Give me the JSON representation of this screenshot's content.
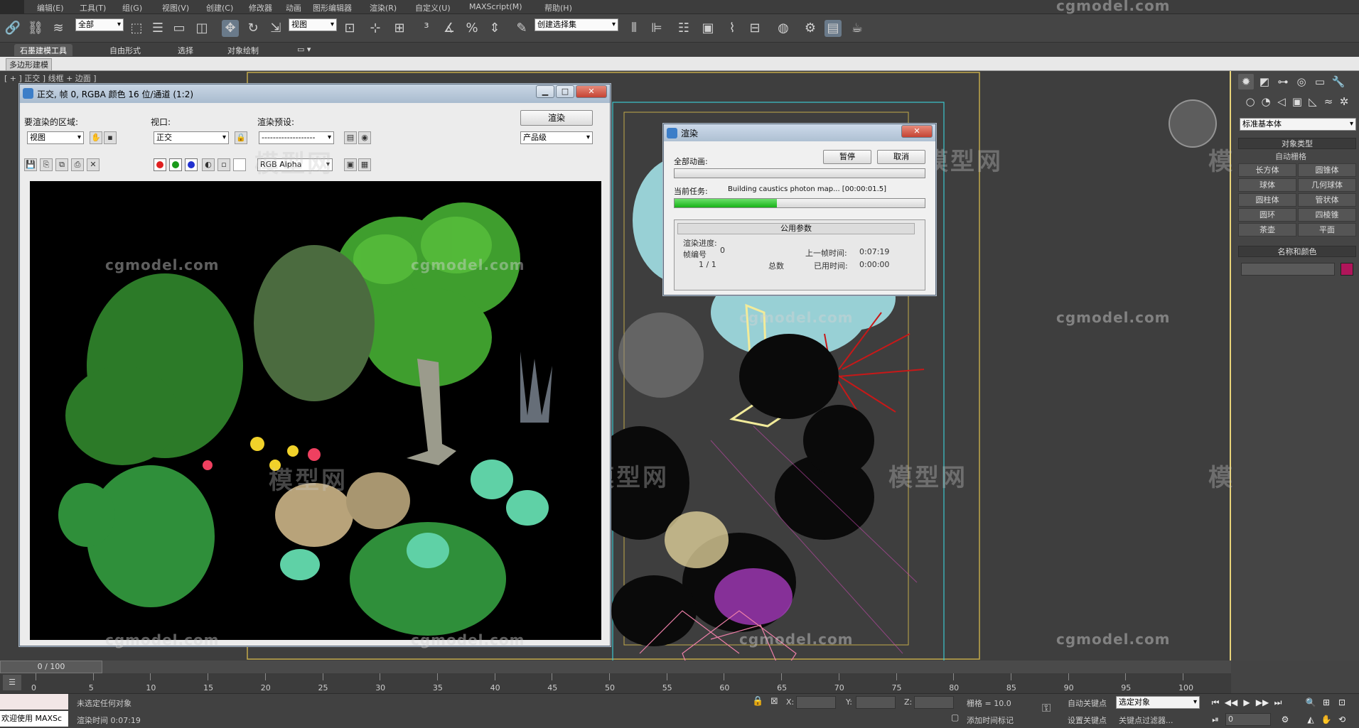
{
  "menubar": {
    "items": [
      "编辑(E)",
      "工具(T)",
      "组(G)",
      "视图(V)",
      "创建(C)",
      "修改器",
      "动画",
      "图形编辑器",
      "渲染(R)",
      "自定义(U)",
      "MAXScript(M)",
      "帮助(H)"
    ]
  },
  "toolbar": {
    "selection_filter": "全部",
    "ref_coord": "视图",
    "named_selection": "创建选择集"
  },
  "ribbon": {
    "tabs": [
      "石墨建模工具",
      "自由形式",
      "选择",
      "对象绘制"
    ],
    "sub_label": "多边形建模"
  },
  "viewport": {
    "label": "[ + ] 正交 ] 线框 + 边面 ]"
  },
  "watermark": {
    "site": "cgmodel.com",
    "brand": "模型网"
  },
  "render_window": {
    "title": "正交, 帧 0, RGBA 颜色 16 位/通道 (1:2)",
    "area_label": "要渲染的区域:",
    "area_value": "视图",
    "viewport_label": "视口:",
    "viewport_value": "正交",
    "preset_label": "渲染预设:",
    "preset_value": "-------------------",
    "render_button": "渲染",
    "quality_value": "产品级",
    "channel_value": "RGB Alpha",
    "min_btn": "▁",
    "max_btn": "□",
    "close_btn": "✕"
  },
  "progress_dialog": {
    "title": "渲染",
    "all_anim_label": "全部动画:",
    "pause_button": "暂停",
    "cancel_button": "取消",
    "current_task_label": "当前任务:",
    "current_task_value": "Building caustics photon map... [00:00:01.5]",
    "current_progress": 0.41,
    "all_progress": 0.0,
    "params_header": "公用参数",
    "render_progress_label": "渲染进度:",
    "frame_label": "帧编号",
    "frame_value": "0",
    "frames_value": "1 / 1",
    "total_label": "总数",
    "last_frame_label": "上一帧时间:",
    "last_frame_value": "0:07:19",
    "elapsed_label": "已用时间:",
    "elapsed_value": "0:00:00",
    "close_btn": "✕"
  },
  "command_panel": {
    "category_value": "标准基本体",
    "object_type_header": "对象类型",
    "autogrid_label": "自动栅格",
    "objects": [
      "长方体",
      "圆锥体",
      "球体",
      "几何球体",
      "圆柱体",
      "管状体",
      "圆环",
      "四棱锥",
      "茶壶",
      "平面"
    ],
    "name_color_header": "名称和颜色",
    "color": "#b0155a"
  },
  "timeline": {
    "slider_label": "0 / 100",
    "ticks": [
      0,
      5,
      10,
      15,
      20,
      25,
      30,
      35,
      40,
      45,
      50,
      55,
      60,
      65,
      70,
      75,
      80,
      85,
      90,
      95,
      100
    ]
  },
  "statusbar": {
    "welcome": "欢迎使用 MAXSc",
    "selection_status": "未选定任何对象",
    "render_time": "渲染时间 0:07:19",
    "x_label": "X:",
    "y_label": "Y:",
    "z_label": "Z:",
    "grid": "栅格 = 10.0",
    "add_time_tag": "添加时间标记",
    "auto_key": "自动关键点",
    "set_key": "设置关键点",
    "key_select": "选定对象",
    "key_filters": "关键点过滤器...",
    "frame_field": "0"
  }
}
